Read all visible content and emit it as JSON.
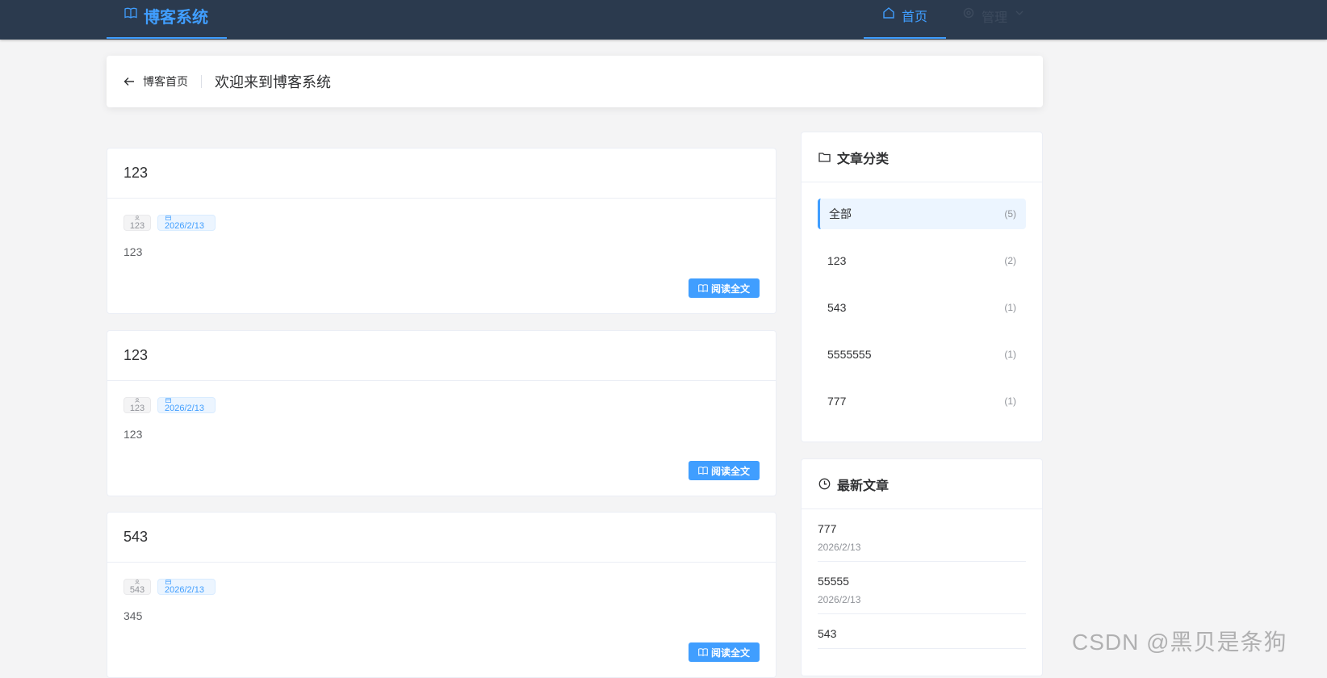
{
  "nav": {
    "brand": "博客系统",
    "home_label": "首页",
    "manage_label": "管理"
  },
  "header": {
    "back_label": "博客首页",
    "title": "欢迎来到博客系统"
  },
  "posts": [
    {
      "title": "123",
      "author": "123",
      "date": "2026/2/13",
      "excerpt": "123",
      "read_label": "阅读全文"
    },
    {
      "title": "123",
      "author": "123",
      "date": "2026/2/13",
      "excerpt": "123",
      "read_label": "阅读全文"
    },
    {
      "title": "543",
      "author": "543",
      "date": "2026/2/13",
      "excerpt": "345",
      "read_label": "阅读全文"
    }
  ],
  "categories": {
    "title": "文章分类",
    "items": [
      {
        "name": "全部",
        "count": "(5)"
      },
      {
        "name": "123",
        "count": "(2)"
      },
      {
        "name": "543",
        "count": "(1)"
      },
      {
        "name": "5555555",
        "count": "(1)"
      },
      {
        "name": "777",
        "count": "(1)"
      }
    ]
  },
  "recent": {
    "title": "最新文章",
    "items": [
      {
        "title": "777",
        "date": "2026/2/13"
      },
      {
        "title": "55555",
        "date": "2026/2/13"
      },
      {
        "title": "543",
        "date": ""
      }
    ]
  },
  "watermark": "CSDN @黑贝是条狗",
  "colors": {
    "primary": "#409eff",
    "topbar": "#2b3a4e",
    "background": "#f4f4f5"
  }
}
